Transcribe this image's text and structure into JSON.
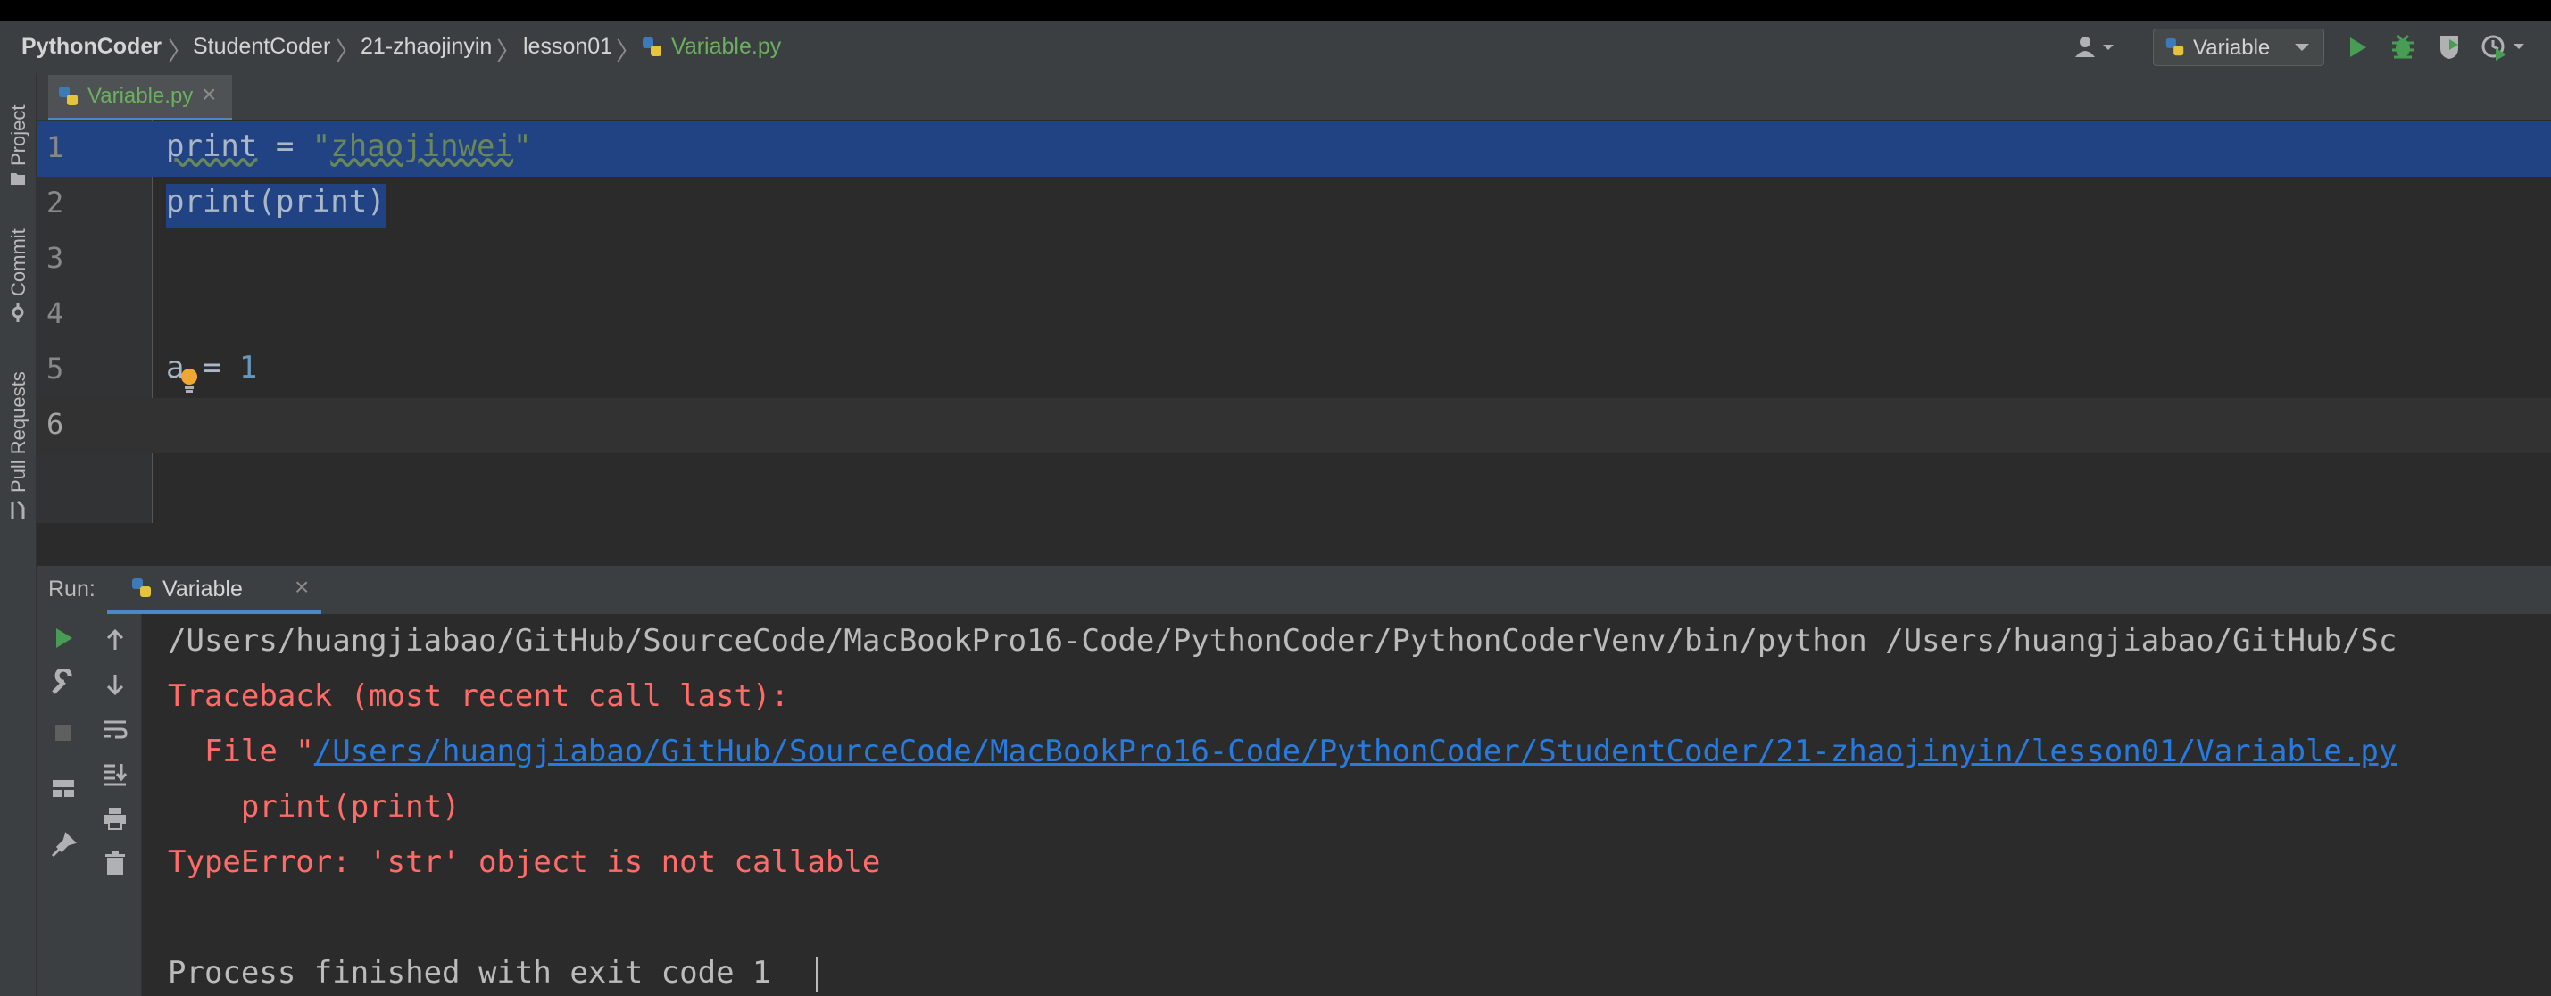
{
  "breadcrumbs": [
    "PythonCoder",
    "StudentCoder",
    "21-zhaojinyin",
    "lesson01",
    "Variable.py"
  ],
  "run_config": {
    "label": "Variable"
  },
  "editor_tab": {
    "label": "Variable.py",
    "close": "×"
  },
  "side_tabs": [
    "Project",
    "Commit",
    "Pull Requests"
  ],
  "editor": {
    "line_numbers": [
      "1",
      "2",
      "3",
      "4",
      "5",
      "6"
    ],
    "lines": {
      "l1_var": "print",
      "l1_eq": " = ",
      "l1_str_open": "\"",
      "l1_str": "zhaojinwei",
      "l1_str_close": "\"",
      "l2": "print(print)",
      "l5_var": "a",
      "l5_eq": " = ",
      "l5_num": "1"
    }
  },
  "run_panel": {
    "label": "Run:",
    "tab": "Variable",
    "tab_close": "×",
    "output": {
      "cmd": "/Users/huangjiabao/GitHub/SourceCode/MacBookPro16-Code/PythonCoder/PythonCoderVenv/bin/python /Users/huangjiabao/GitHub/Sc",
      "traceback": "Traceback (most recent call last):",
      "file_prefix": "  File \"",
      "file_link": "/Users/huangjiabao/GitHub/SourceCode/MacBookPro16-Code/PythonCoder/StudentCoder/21-zhaojinyin/lesson01/Variable.py",
      "code_line": "    print(print)",
      "error": "TypeError: 'str' object is not callable",
      "finished": "Process finished with exit code 1"
    }
  },
  "colors": {
    "selection": "#214283",
    "error_red": "#ff6b68",
    "link_blue": "#287bde",
    "string_green": "#6a8759",
    "number_blue": "#6897bb",
    "run_green": "#499c54"
  }
}
